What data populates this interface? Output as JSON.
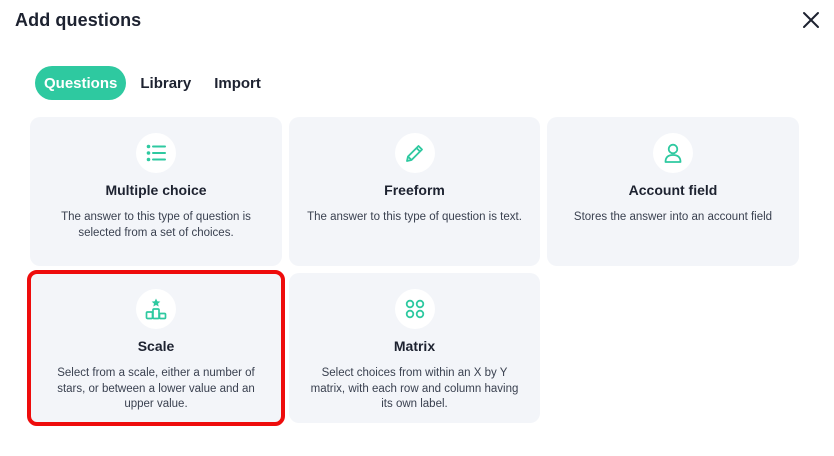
{
  "modal": {
    "title": "Add questions",
    "close_icon": "close-icon"
  },
  "tabs": [
    {
      "label": "Questions",
      "active": true
    },
    {
      "label": "Library",
      "active": false
    },
    {
      "label": "Import",
      "active": false
    }
  ],
  "question_types": [
    {
      "title": "Multiple choice",
      "description": "The answer to this type of question is selected from a set of choices.",
      "icon": "list-icon"
    },
    {
      "title": "Freeform",
      "description": "The answer to this type of question is text.",
      "icon": "pencil-icon"
    },
    {
      "title": "Account field",
      "description": "Stores the answer into an account field",
      "icon": "user-icon"
    },
    {
      "title": "Scale",
      "description": "Select from a scale, either a number of stars, or between a lower value and an upper value.",
      "icon": "podium-star-icon"
    },
    {
      "title": "Matrix",
      "description": "Select choices from within an X by Y matrix, with each row and column having its own label.",
      "icon": "grid-icon"
    }
  ],
  "colors": {
    "accent": "#2ec9a0",
    "card_bg": "#f3f5f9",
    "highlight": "#ee0c0c"
  }
}
